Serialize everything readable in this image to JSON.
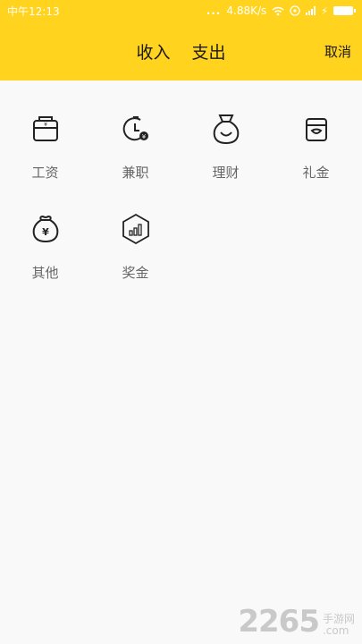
{
  "status_bar": {
    "time": "中午12:13",
    "dots": "...",
    "speed": "4.88K/s"
  },
  "header": {
    "tabs": [
      {
        "label": "收入"
      },
      {
        "label": "支出"
      }
    ],
    "cancel_label": "取消"
  },
  "categories": [
    {
      "label": "工资",
      "icon": "wallet-icon"
    },
    {
      "label": "兼职",
      "icon": "clock-coin-icon"
    },
    {
      "label": "理财",
      "icon": "money-bag-icon"
    },
    {
      "label": "礼金",
      "icon": "gift-box-icon"
    },
    {
      "label": "其他",
      "icon": "coin-bag-icon"
    },
    {
      "label": "奖金",
      "icon": "hexagon-chart-icon"
    }
  ],
  "watermark": {
    "number": "2265",
    "text_top": "手游网",
    "text_bottom": ".com"
  },
  "colors": {
    "accent": "#ffd31e",
    "background": "#f9f9f9",
    "label": "#666666"
  }
}
